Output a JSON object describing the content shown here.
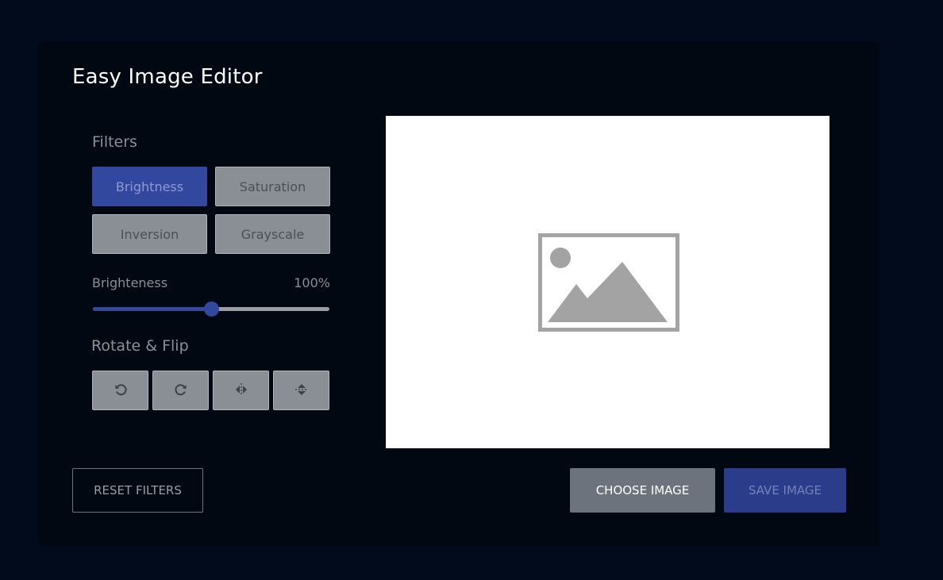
{
  "app": {
    "title": "Easy Image Editor"
  },
  "filters": {
    "label": "Filters",
    "buttons": [
      {
        "label": "Brightness",
        "active": true
      },
      {
        "label": "Saturation",
        "active": false
      },
      {
        "label": "Inversion",
        "active": false
      },
      {
        "label": "Grayscale",
        "active": false
      }
    ]
  },
  "slider": {
    "name": "Brighteness",
    "value_text": "100%",
    "level_fraction": 0.5
  },
  "rotate_flip": {
    "label": "Rotate & Flip",
    "buttons": [
      {
        "icon": "rotate-left-icon"
      },
      {
        "icon": "rotate-right-icon"
      },
      {
        "icon": "flip-horizontal-icon"
      },
      {
        "icon": "flip-vertical-icon"
      }
    ]
  },
  "preview": {
    "icon": "image-placeholder-icon"
  },
  "actions": {
    "reset_label": "RESET FILTERS",
    "choose_label": "CHOOSE IMAGE",
    "save_label": "SAVE IMAGE"
  },
  "colors": {
    "background": "#010b1c",
    "card": "#010812",
    "accent": "#32479e",
    "button_grey": "#8a8f95",
    "choose_button": "#6c737c"
  }
}
